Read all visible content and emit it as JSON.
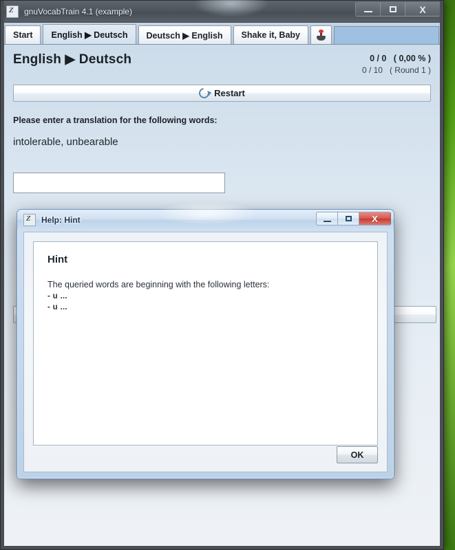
{
  "main_window": {
    "title": "gnuVocabTrain 4.1 (example)",
    "icon": "app-icon",
    "controls": {
      "minimize": "minimize-icon",
      "maximize": "maximize-icon",
      "close": "X"
    },
    "tabs": [
      {
        "label": "Start",
        "selected": false,
        "icon": null
      },
      {
        "label": "English ▶ Deutsch",
        "selected": true,
        "icon": null
      },
      {
        "label": "Deutsch ▶ English",
        "selected": false,
        "icon": null
      },
      {
        "label": "Shake it, Baby",
        "selected": false,
        "icon": null
      },
      {
        "label": "",
        "selected": false,
        "icon": "joystick-icon"
      }
    ],
    "content": {
      "page_title": "English ▶ Deutsch",
      "score_main": "0 / 0   ( 0,00 % )",
      "score_sub": "0 / 10   ( Round 1 )",
      "restart_label": "Restart",
      "restart_icon": "restart-icon",
      "prompt_label": "Please enter a translation for the following words:",
      "query_words": "intolerable, unbearable",
      "answer_value": "",
      "answer_placeholder": ""
    }
  },
  "hint_dialog": {
    "title": "Help: Hint",
    "icon": "app-icon",
    "controls": {
      "minimize": "minimize-icon",
      "maximize": "maximize-icon",
      "close": "X"
    },
    "heading": "Hint",
    "intro": "The queried words are beginning with the following letters:",
    "lines": [
      "- u ...",
      "- u ..."
    ],
    "ok_label": "OK"
  },
  "colors": {
    "desktop_green": "#54a315",
    "dialog_close_red": "#c33b32",
    "tab_selected_bg": "#d4e1ee",
    "content_bg": "#dde8f2"
  }
}
